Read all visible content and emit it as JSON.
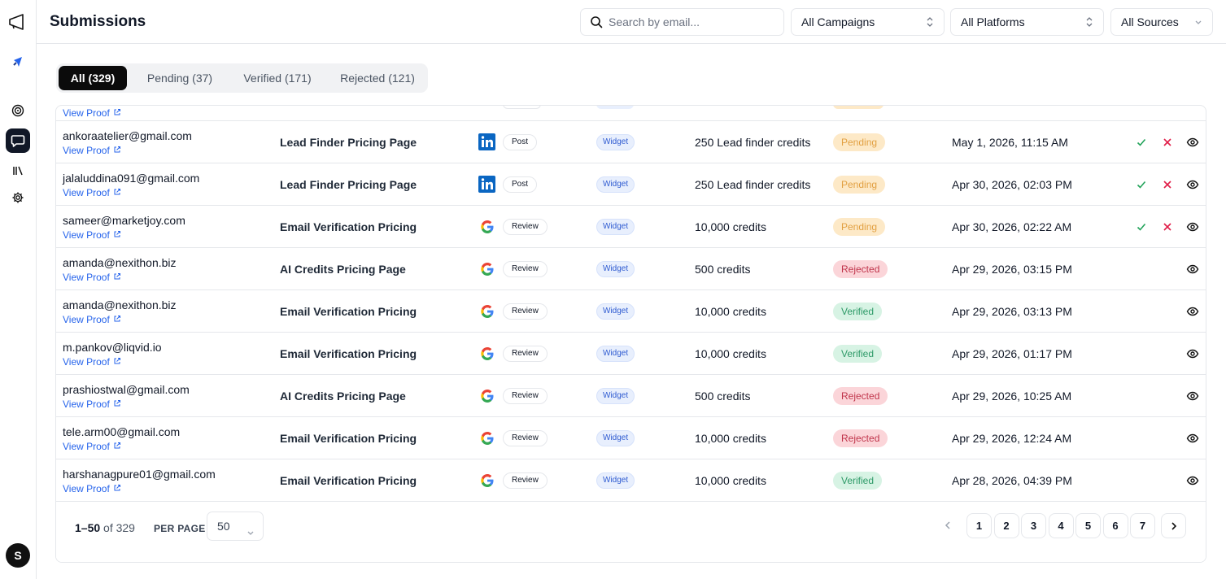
{
  "header": {
    "title": "Submissions",
    "search_placeholder": "Search by email...",
    "campaign_filter": "All Campaigns",
    "platform_filter": "All Platforms",
    "source_filter": "All Sources"
  },
  "tabs": [
    {
      "label": "All (329)",
      "active": true
    },
    {
      "label": "Pending (37)",
      "active": false
    },
    {
      "label": "Verified (171)",
      "active": false
    },
    {
      "label": "Rejected (121)",
      "active": false
    }
  ],
  "partial_top_row": {
    "proof_label": "View Proof"
  },
  "rows": [
    {
      "email": "ankoraatelier@gmail.com",
      "proof": "View Proof",
      "campaign": "Lead Finder Pricing Page",
      "platform": "linkedin-icon",
      "type": "Post",
      "source": "Widget",
      "reward": "250 Lead finder credits",
      "status": "Pending",
      "date": "May 1, 2026, 11:15 AM",
      "actions": true
    },
    {
      "email": "jalaluddina091@gmail.com",
      "proof": "View Proof",
      "campaign": "Lead Finder Pricing Page",
      "platform": "linkedin-icon",
      "type": "Post",
      "source": "Widget",
      "reward": "250 Lead finder credits",
      "status": "Pending",
      "date": "Apr 30, 2026, 02:03 PM",
      "actions": true
    },
    {
      "email": "sameer@marketjoy.com",
      "proof": "View Proof",
      "campaign": "Email Verification Pricing",
      "platform": "google-icon",
      "type": "Review",
      "source": "Widget",
      "reward": "10,000 credits",
      "status": "Pending",
      "date": "Apr 30, 2026, 02:22 AM",
      "actions": true
    },
    {
      "email": "amanda@nexithon.biz",
      "proof": "View Proof",
      "campaign": "AI Credits Pricing Page",
      "platform": "google-icon",
      "type": "Review",
      "source": "Widget",
      "reward": "500 credits",
      "status": "Rejected",
      "date": "Apr 29, 2026, 03:15 PM",
      "actions": false
    },
    {
      "email": "amanda@nexithon.biz",
      "proof": "View Proof",
      "campaign": "Email Verification Pricing",
      "platform": "google-icon",
      "type": "Review",
      "source": "Widget",
      "reward": "10,000 credits",
      "status": "Verified",
      "date": "Apr 29, 2026, 03:13 PM",
      "actions": false
    },
    {
      "email": "m.pankov@liqvid.io",
      "proof": "View Proof",
      "campaign": "Email Verification Pricing",
      "platform": "google-icon",
      "type": "Review",
      "source": "Widget",
      "reward": "10,000 credits",
      "status": "Verified",
      "date": "Apr 29, 2026, 01:17 PM",
      "actions": false
    },
    {
      "email": "prashiostwal@gmail.com",
      "proof": "View Proof",
      "campaign": "AI Credits Pricing Page",
      "platform": "google-icon",
      "type": "Review",
      "source": "Widget",
      "reward": "500 credits",
      "status": "Rejected",
      "date": "Apr 29, 2026, 10:25 AM",
      "actions": false
    },
    {
      "email": "tele.arm00@gmail.com",
      "proof": "View Proof",
      "campaign": "Email Verification Pricing",
      "platform": "google-icon",
      "type": "Review",
      "source": "Widget",
      "reward": "10,000 credits",
      "status": "Rejected",
      "date": "Apr 29, 2026, 12:24 AM",
      "actions": false
    },
    {
      "email": "harshanagpure01@gmail.com",
      "proof": "View Proof",
      "campaign": "Email Verification Pricing",
      "platform": "google-icon",
      "type": "Review",
      "source": "Widget",
      "reward": "10,000 credits",
      "status": "Verified",
      "date": "Apr 28, 2026, 04:39 PM",
      "actions": false
    }
  ],
  "pagination": {
    "range": "1–50",
    "of_text": "of 329",
    "per_page_label": "PER PAGE",
    "per_page_value": "50",
    "pages": [
      "1",
      "2",
      "3",
      "4",
      "5",
      "6",
      "7"
    ]
  },
  "user": {
    "initial": "S"
  },
  "colors": {
    "pending_bg": "#fde9c7",
    "pending_fg": "#e2a042",
    "rejected_bg": "#fbd5d9",
    "rejected_fg": "#c0344b",
    "verified_bg": "#d7f3e4",
    "verified_fg": "#2e9a68",
    "link": "#2563eb",
    "linkedin": "#0a66c2"
  }
}
